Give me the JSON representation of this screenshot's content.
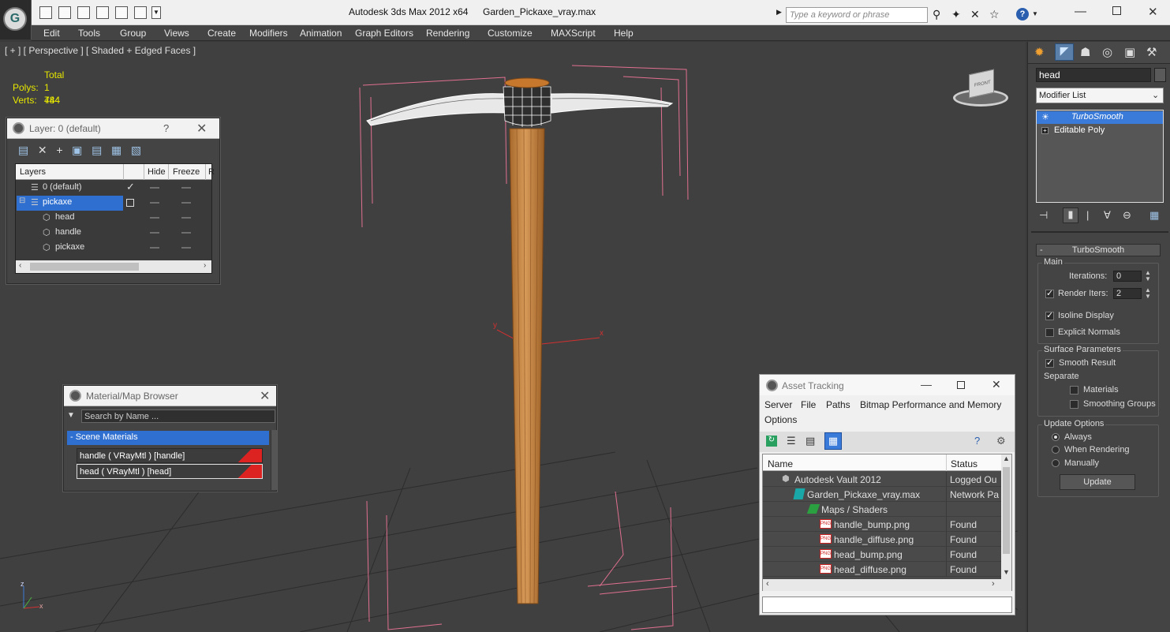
{
  "app": {
    "title": "Autodesk 3ds Max  2012 x64",
    "file": "Garden_Pickaxe_vray.max",
    "search_placeholder": "Type a keyword or phrase"
  },
  "menu": [
    "Edit",
    "Tools",
    "Group",
    "Views",
    "Create",
    "Modifiers",
    "Animation",
    "Graph Editors",
    "Rendering",
    "Customize",
    "MAXScript",
    "Help"
  ],
  "viewport": {
    "label": "[ + ] [ Perspective ] [ Shaded + Edged Faces ]",
    "stats": {
      "total_label": "Total",
      "polys_label": "Polys:",
      "polys": "1 484",
      "verts_label": "Verts:",
      "verts": "744"
    },
    "viewcube_label": "FRONT",
    "axis": {
      "x": "x",
      "y": "y",
      "z": "z"
    }
  },
  "layer_window": {
    "title": "Layer: 0 (default)",
    "help": "?",
    "columns": [
      "Layers",
      "",
      "Hide",
      "Freeze",
      "R"
    ],
    "rows": [
      {
        "name": "0 (default)",
        "indent": 0
      },
      {
        "name": "pickaxe",
        "indent": 0
      },
      {
        "name": "head",
        "indent": 1
      },
      {
        "name": "handle",
        "indent": 1
      },
      {
        "name": "pickaxe",
        "indent": 1
      }
    ]
  },
  "material_browser": {
    "title": "Material/Map Browser",
    "search_placeholder": "Search by Name ...",
    "group": "- Scene Materials",
    "items": [
      "handle  ( VRayMtl )  [handle]",
      "head  ( VRayMtl )  [head]"
    ]
  },
  "asset_tracking": {
    "title": "Asset Tracking",
    "menu": [
      "Server",
      "File",
      "Paths",
      "Bitmap Performance and Memory",
      "Options"
    ],
    "columns": [
      "Name",
      "Status"
    ],
    "rows": [
      {
        "name": "Autodesk Vault 2012",
        "status": "Logged Ou",
        "level": 0,
        "icon": "vault"
      },
      {
        "name": "Garden_Pickaxe_vray.max",
        "status": "Network Pa",
        "level": 1,
        "icon": "max"
      },
      {
        "name": "Maps / Shaders",
        "status": "",
        "level": 2,
        "icon": "maps"
      },
      {
        "name": "handle_bump.png",
        "status": "Found",
        "level": 3,
        "icon": "png"
      },
      {
        "name": "handle_diffuse.png",
        "status": "Found",
        "level": 3,
        "icon": "png"
      },
      {
        "name": "head_bump.png",
        "status": "Found",
        "level": 3,
        "icon": "png"
      },
      {
        "name": "head_diffuse.png",
        "status": "Found",
        "level": 3,
        "icon": "png"
      }
    ]
  },
  "command_panel": {
    "object_name": "head",
    "modifier_list": "Modifier List",
    "stack": [
      "TurboSmooth",
      "Editable Poly"
    ],
    "rollout": "TurboSmooth",
    "collapse": "-",
    "main_label": "Main",
    "iterations_label": "Iterations:",
    "iterations": "0",
    "render_iters_label": "Render Iters:",
    "render_iters": "2",
    "isoline_label": "Isoline Display",
    "explicit_label": "Explicit Normals",
    "surface_label": "Surface Parameters",
    "smooth_label": "Smooth Result",
    "separate_label": "Separate",
    "materials_label": "Materials",
    "smoothing_label": "Smoothing Groups",
    "update_label": "Update Options",
    "always_label": "Always",
    "when_label": "When Rendering",
    "manually_label": "Manually",
    "update_button": "Update"
  }
}
